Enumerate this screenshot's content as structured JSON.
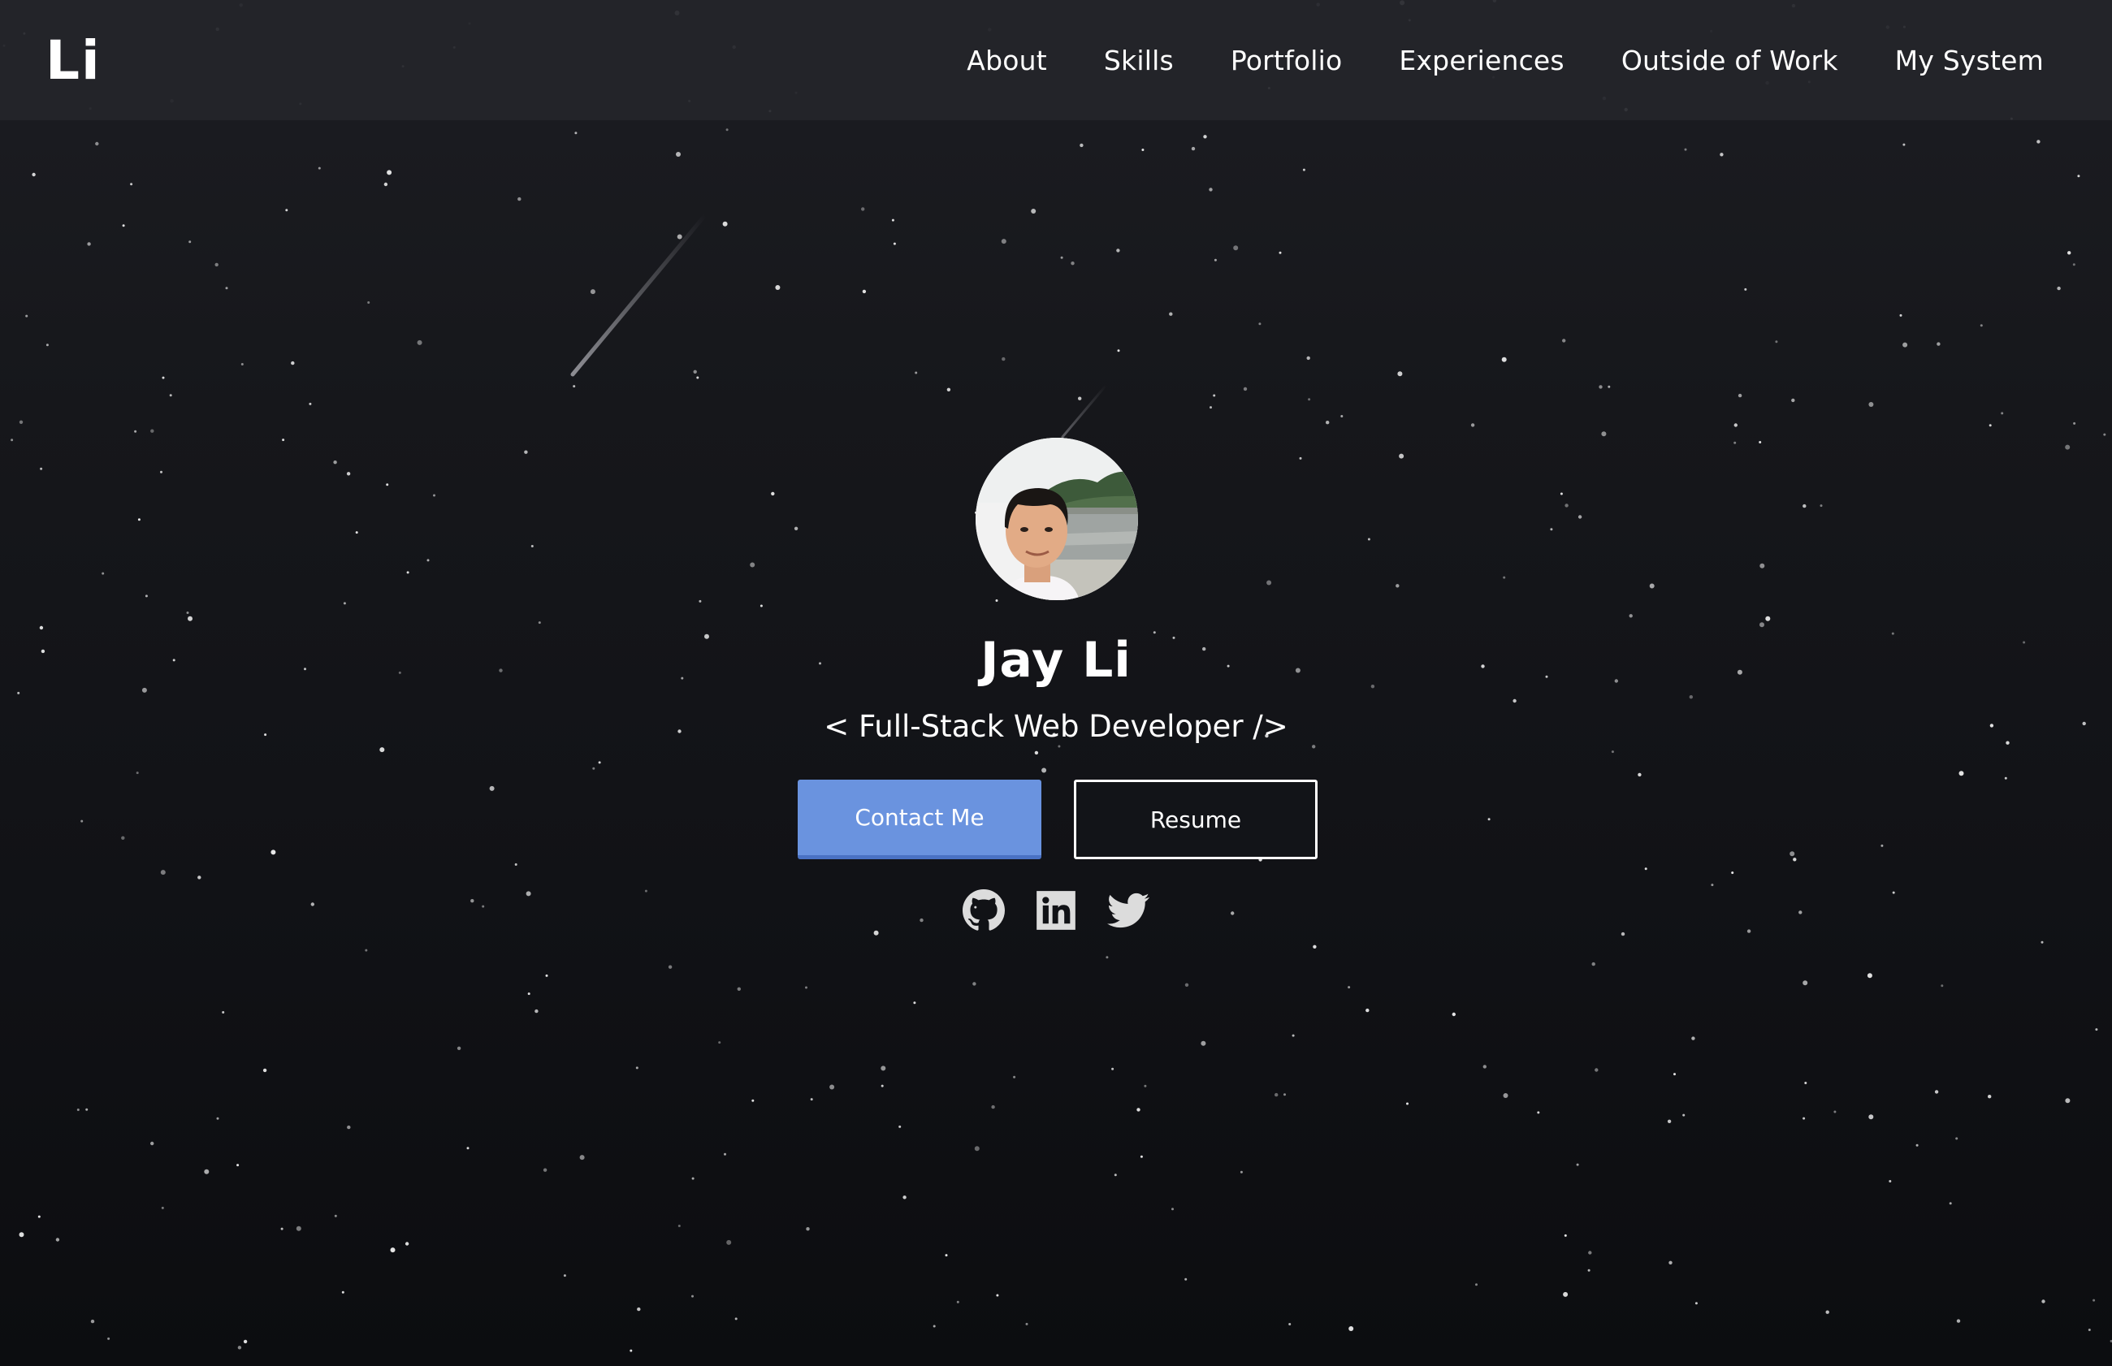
{
  "header": {
    "logo": "Li",
    "nav": [
      {
        "label": "About"
      },
      {
        "label": "Skills"
      },
      {
        "label": "Portfolio"
      },
      {
        "label": "Experiences"
      },
      {
        "label": "Outside of Work"
      },
      {
        "label": "My System"
      }
    ]
  },
  "hero": {
    "name": "Jay Li",
    "subtitle": "< Full-Stack Web Developer />",
    "contact_label": "Contact Me",
    "resume_label": "Resume",
    "socials": [
      {
        "icon": "github-icon"
      },
      {
        "icon": "linkedin-icon"
      },
      {
        "icon": "twitter-icon"
      }
    ]
  },
  "colors": {
    "background": "#111216",
    "navbar": "#24252a",
    "accent": "#6a93df",
    "icon": "#dcdcdc"
  }
}
